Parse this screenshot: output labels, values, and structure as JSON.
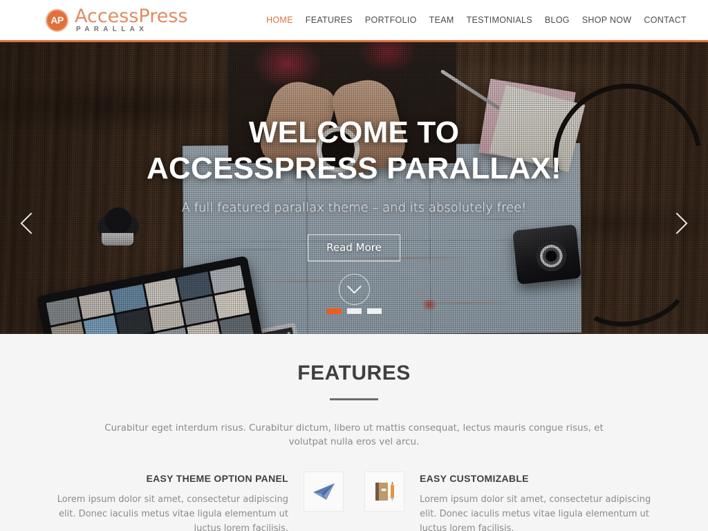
{
  "header": {
    "logo": {
      "badge": "AP",
      "main": "AccessPress",
      "sub": "PARALLAX"
    },
    "nav": [
      {
        "label": "HOME",
        "active": true
      },
      {
        "label": "FEATURES",
        "active": false
      },
      {
        "label": "PORTFOLIO",
        "active": false
      },
      {
        "label": "TEAM",
        "active": false
      },
      {
        "label": "TESTIMONIALS",
        "active": false
      },
      {
        "label": "BLOG",
        "active": false
      },
      {
        "label": "SHOP NOW",
        "active": false
      },
      {
        "label": "CONTACT",
        "active": false
      }
    ],
    "accent_color": "#e2703a"
  },
  "hero": {
    "title": "WELCOME TO ACCESSPRESS PARALLAX!",
    "subtitle": "A full featured parallax theme – and its absolutely free!",
    "button_label": "Read More",
    "scroll_icon": "chevron-down-icon",
    "prev_icon": "chevron-left-icon",
    "next_icon": "chevron-right-icon",
    "slides": [
      {
        "index": 1,
        "active": true
      },
      {
        "index": 2,
        "active": false
      },
      {
        "index": 3,
        "active": false
      }
    ],
    "active_dot_color": "#ef5a1e"
  },
  "features": {
    "title": "FEATURES",
    "description": "Curabitur eget interdum risus. Curabitur dictum, libero ut mattis consequat, lectus mauris congue risus, et volutpat nulla eros vel arcu.",
    "items": [
      {
        "title": "EASY THEME OPTION PANEL",
        "text": "Lorem ipsum dolor sit amet, consectetur adipiscing elit. Donec iaculis metus vitae ligula elementum ut luctus lorem facilisis.",
        "icon": "paper-plane-icon",
        "icon_side": "right"
      },
      {
        "title": "EASY CUSTOMIZABLE",
        "text": "Lorem ipsum dolor sit amet, consectetur adipiscing elit. Donec iaculis metus vitae ligula elementum ut luctus lorem facilisis.",
        "icon": "notebook-pencil-icon",
        "icon_side": "left"
      }
    ]
  }
}
